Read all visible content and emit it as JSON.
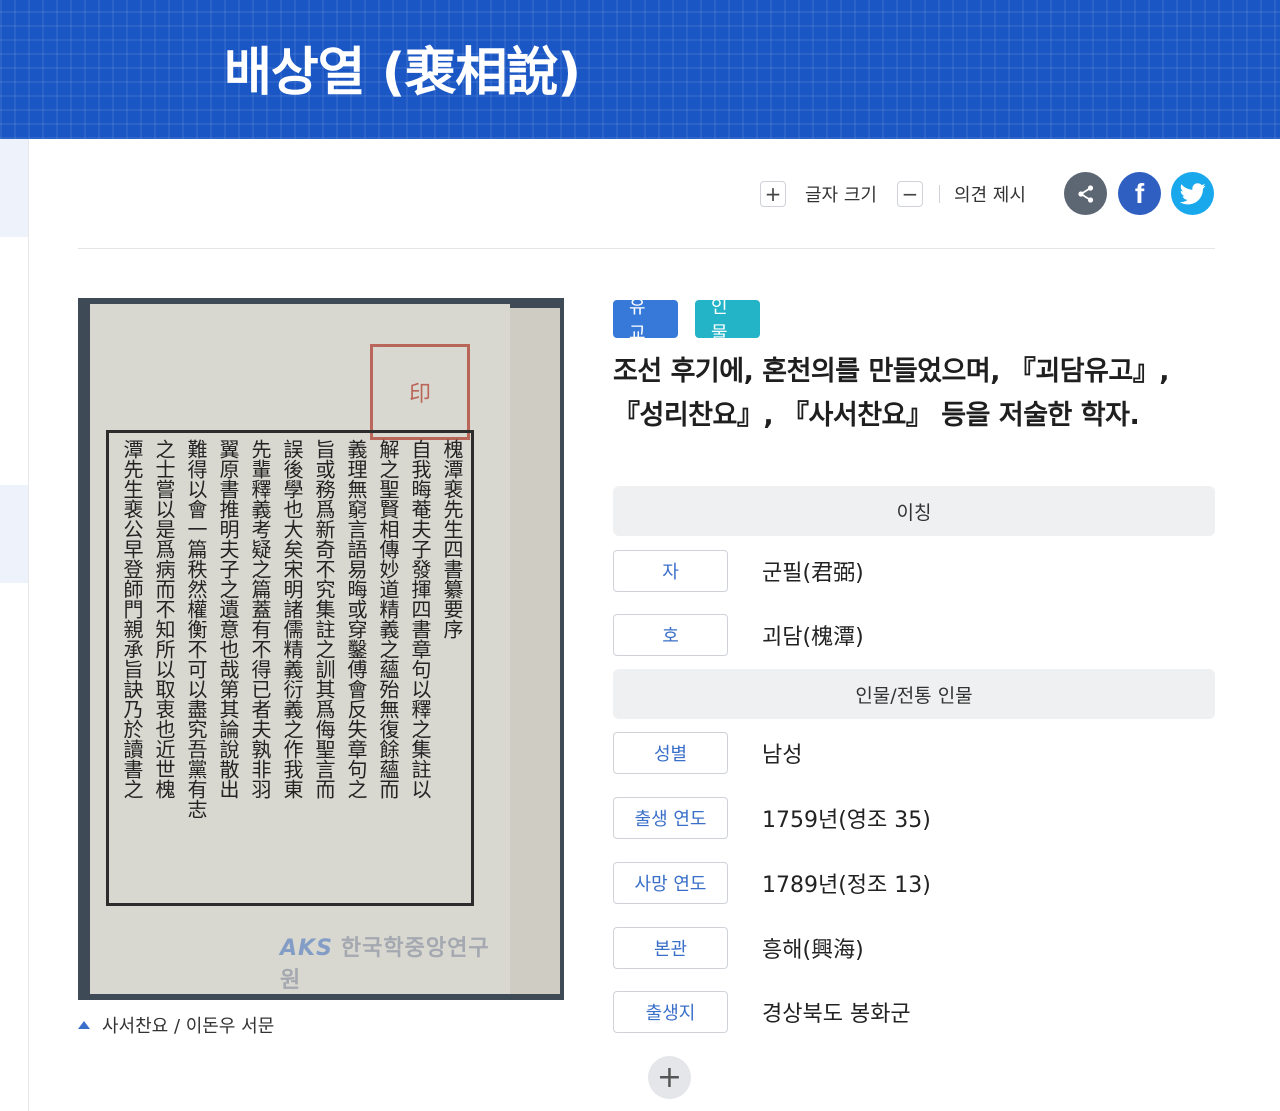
{
  "header": {
    "title": "배상열 (裵相說)"
  },
  "toolbar": {
    "font_increase": "+",
    "font_size_label": "글자 크기",
    "font_decrease": "−",
    "opinion_label": "의견 제시",
    "facebook_glyph": "f"
  },
  "image": {
    "caption": "사서찬요 / 이돈우 서문",
    "watermark_logo": "AKS",
    "watermark_text": "한국학중앙연구원",
    "stamp_text": "印",
    "columns": [
      "槐潭裵先生四書纂要序",
      "自我晦菴夫子發揮四書章句以釋之集註以",
      "解之聖賢相傳妙道精義之蘊殆無復餘蘊而",
      "義理無窮言語易晦或穿鑿傅會反失章句之",
      "旨或務爲新奇不究集註之訓其爲侮聖言而",
      "誤後學也大矣宋明諸儒精義衍義之作我東",
      "先輩釋義考疑之篇蓋有不得已者夫孰非羽",
      "翼原書推明夫子之遺意也哉第其論說散出",
      "難得以會一篇秩然權衡不可以盡究吾黨有志",
      "之士嘗以是爲病而不知所以取衷也近世槐",
      "潭先生裵公早登師門親承旨訣乃於讀書之"
    ]
  },
  "tags": [
    "유교",
    "인물"
  ],
  "summary": {
    "line1": "조선 후기에, 혼천의를 만들었으며, 『괴담유고』,",
    "line2": "『성리찬요』, 『사서찬요』 등을 저술한 학자."
  },
  "sections": {
    "alias": {
      "title": "이칭",
      "rows": [
        {
          "label": "자",
          "value": "군필(君弼)"
        },
        {
          "label": "호",
          "value": "괴담(槐潭)"
        }
      ]
    },
    "person": {
      "title": "인물/전통 인물",
      "rows": [
        {
          "label": "성별",
          "value": "남성"
        },
        {
          "label": "출생 연도",
          "value": "1759년(영조 35)"
        },
        {
          "label": "사망 연도",
          "value": "1789년(정조 13)"
        },
        {
          "label": "본관",
          "value": "흥해(興海)"
        },
        {
          "label": "출생지",
          "value": "경상북도 봉화군"
        }
      ]
    }
  },
  "more_button": "+"
}
